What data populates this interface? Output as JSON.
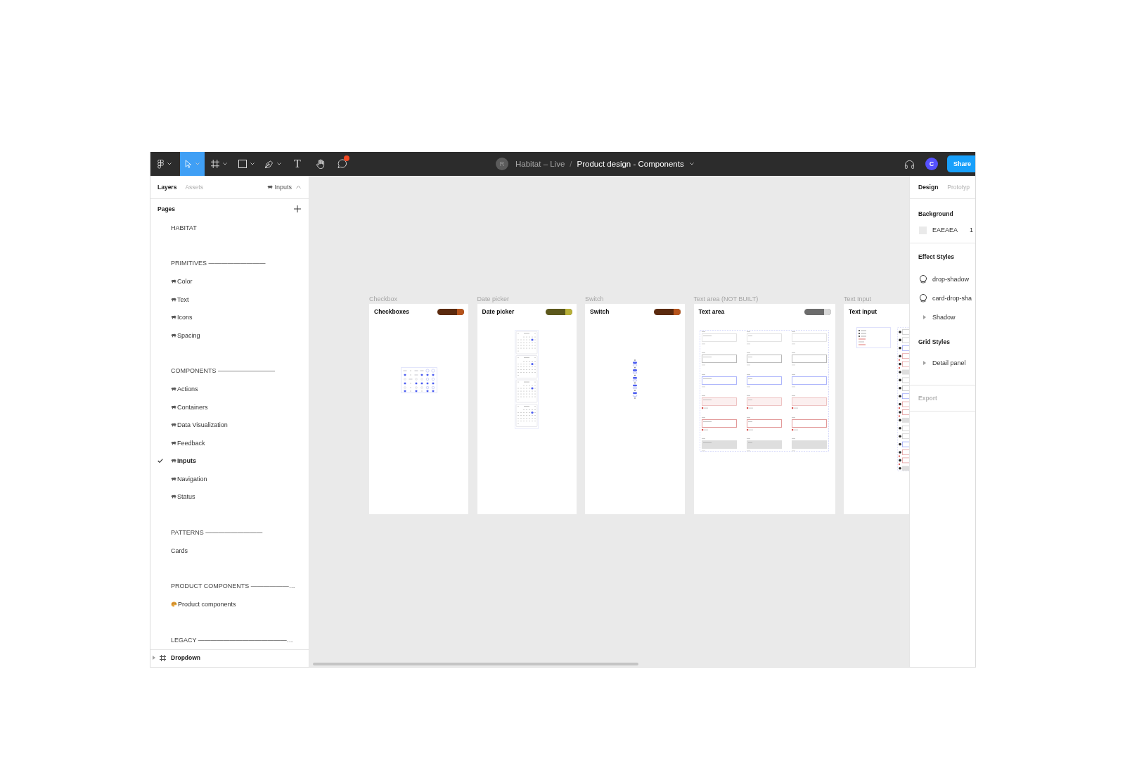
{
  "toolbar": {
    "tools": [
      {
        "kind": "menu",
        "selected": false,
        "dropdown": true,
        "unread": false
      },
      {
        "kind": "move",
        "selected": true,
        "dropdown": true,
        "unread": false
      },
      {
        "kind": "frame",
        "selected": false,
        "dropdown": true,
        "unread": false
      },
      {
        "kind": "shape",
        "selected": false,
        "dropdown": true,
        "unread": false
      },
      {
        "kind": "pen",
        "selected": false,
        "dropdown": true,
        "unread": false
      },
      {
        "kind": "text",
        "glyph": "T",
        "selected": false,
        "dropdown": false,
        "unread": false
      },
      {
        "kind": "hand",
        "selected": false,
        "dropdown": false,
        "unread": false
      },
      {
        "kind": "comment",
        "selected": false,
        "dropdown": false,
        "unread": true
      }
    ],
    "owner_avatar": "R",
    "project": "Habitat – Live",
    "separator": "/",
    "file_name": "Product design - Components",
    "user_avatar": "C",
    "share_button": "Share"
  },
  "layers_panel": {
    "tabs": [
      {
        "label": "Layers",
        "selected": true
      },
      {
        "label": "Assets",
        "selected": false
      }
    ],
    "current_page": "Inputs",
    "pages_title": "Pages",
    "page_groups": [
      {
        "items": [
          {
            "kind": "plain",
            "label": "HABITAT",
            "selected": false
          }
        ]
      },
      {
        "heading": "PRIMITIVES —————————",
        "items": [
          {
            "kind": "library",
            "label": "Color",
            "selected": false
          },
          {
            "kind": "library",
            "label": "Text",
            "selected": false
          },
          {
            "kind": "library",
            "label": "Icons",
            "selected": false
          },
          {
            "kind": "library",
            "label": "Spacing",
            "selected": false
          }
        ]
      },
      {
        "heading": "COMPONENTS —————————",
        "items": [
          {
            "kind": "library",
            "label": "Actions",
            "selected": false
          },
          {
            "kind": "library",
            "label": "Containers",
            "selected": false
          },
          {
            "kind": "library",
            "label": "Data Visualization",
            "selected": false
          },
          {
            "kind": "library",
            "label": "Feedback",
            "selected": false
          },
          {
            "kind": "library",
            "label": "Inputs",
            "selected": true
          },
          {
            "kind": "library",
            "label": "Navigation",
            "selected": false
          },
          {
            "kind": "library",
            "label": "Status",
            "selected": false
          }
        ]
      },
      {
        "heading": "PATTERNS —————————",
        "items": [
          {
            "kind": "plain",
            "label": "Cards",
            "selected": false
          }
        ]
      },
      {
        "heading": "PRODUCT COMPONENTS ——————…",
        "items": [
          {
            "kind": "product",
            "label": "Product components",
            "selected": false
          }
        ]
      },
      {
        "heading": "LEGACY ——————————————…"
      }
    ],
    "layers": [
      {
        "label": "Dropdown",
        "expanded": false
      }
    ]
  },
  "canvas": {
    "frames": [
      {
        "kind": "checkbox",
        "label": "Checkbox",
        "title": "Checkboxes",
        "badge": {
          "color": "#5b2a0e"
        }
      },
      {
        "kind": "datepicker",
        "label": "Date picker",
        "title": "Date picker",
        "badge": {
          "color": "#5c581c"
        }
      },
      {
        "kind": "switch",
        "label": "Switch",
        "title": "Switch",
        "badge": {
          "color": "#5b2a0e"
        }
      },
      {
        "kind": "textarea",
        "label": "Text area (NOT BUILT)",
        "title": "Text area",
        "badge": {
          "color": "#6c6c6c"
        }
      },
      {
        "kind": "textinput",
        "label": "Text Input",
        "title": "Text input"
      }
    ]
  },
  "design_panel": {
    "tabs": [
      {
        "label": "Design",
        "selected": true
      },
      {
        "label": "Prototyp",
        "selected": false
      }
    ],
    "background": {
      "title": "Background",
      "color": "#eaeaea",
      "hex": "EAEAEA",
      "opacity": "1"
    },
    "style_groups": [
      {
        "title": "Effect Styles",
        "items": [
          {
            "kind": "style",
            "label": "drop-shadow"
          },
          {
            "kind": "style",
            "label": "card-drop-sha"
          },
          {
            "kind": "folder",
            "label": "Shadow",
            "expanded": false
          }
        ]
      },
      {
        "title": "Grid Styles",
        "items": [
          {
            "kind": "folder",
            "label": "Detail panel",
            "expanded": false
          }
        ]
      }
    ],
    "export": {
      "title": "Export",
      "disabled": true
    }
  }
}
